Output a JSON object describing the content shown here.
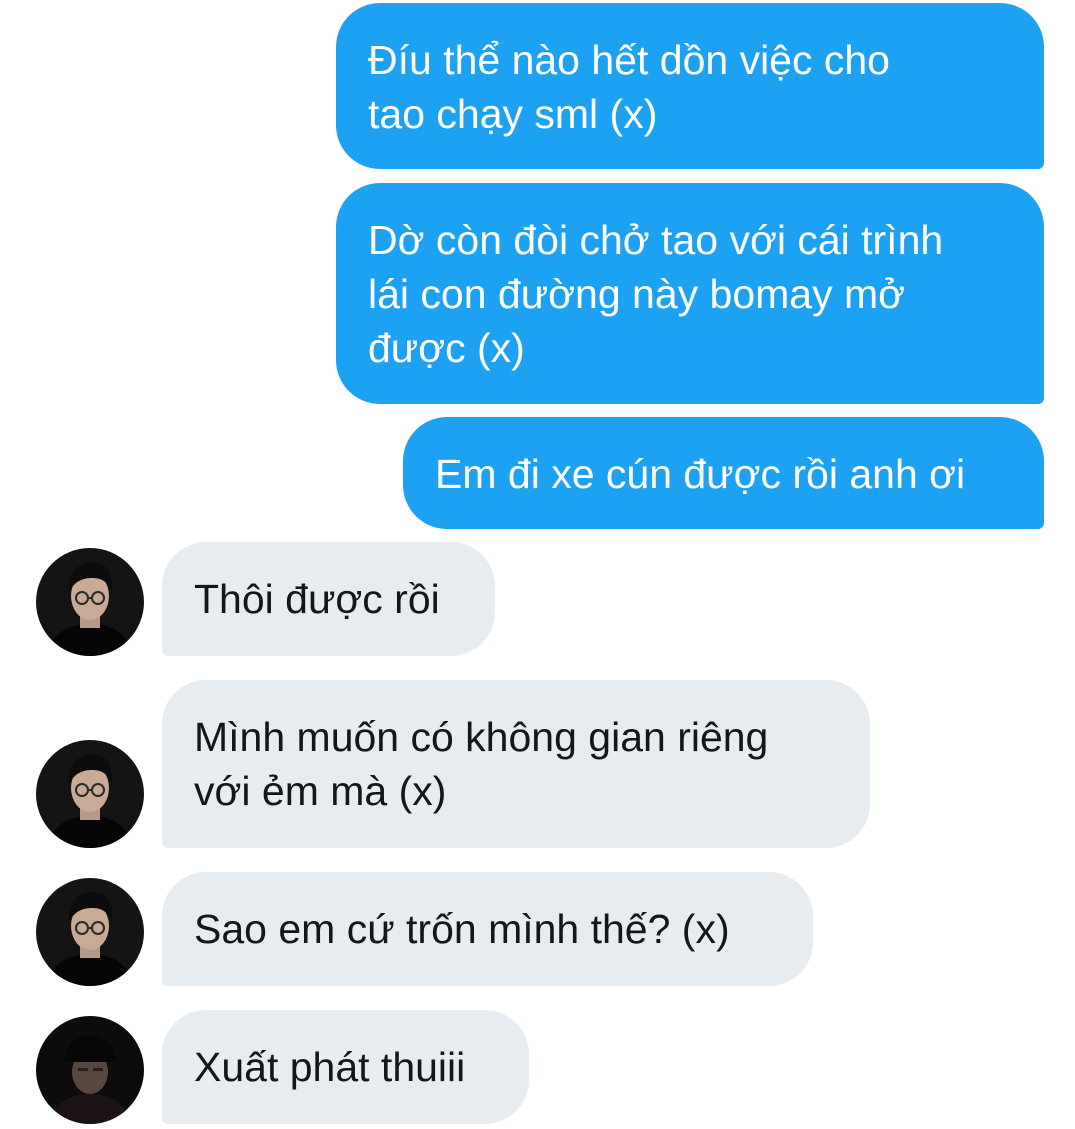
{
  "conversation": {
    "messages": [
      {
        "direction": "sent",
        "lines": [
          "Đíu thể nào hết dồn việc cho",
          "tao chạy sml (x)"
        ]
      },
      {
        "direction": "sent",
        "lines": [
          "Dờ còn đòi chở tao với cái trình",
          "lái con đường này bomay mở",
          "được (x)"
        ]
      },
      {
        "direction": "sent",
        "lines": [
          "Em đi xe cún được rồi anh ơi"
        ]
      },
      {
        "direction": "received",
        "avatar": "profile-photo-man-glasses",
        "lines": [
          "Thôi được rồi"
        ]
      },
      {
        "direction": "received",
        "avatar": "profile-photo-man-glasses",
        "lines": [
          "Mình muốn có không gian riêng",
          "với ẻm mà (x)"
        ]
      },
      {
        "direction": "received",
        "avatar": "profile-photo-man-glasses",
        "lines": [
          "Sao em cứ trốn mình thế? (x)"
        ]
      },
      {
        "direction": "received",
        "avatar": "profile-photo-man-cap",
        "lines": [
          "Xuất phát thuiii"
        ]
      }
    ]
  },
  "colors": {
    "sent_bubble": "#1da1f2",
    "sent_text": "#ffffff",
    "received_bubble": "#e6ecf0",
    "received_text": "#14171a",
    "background": "#ffffff"
  }
}
